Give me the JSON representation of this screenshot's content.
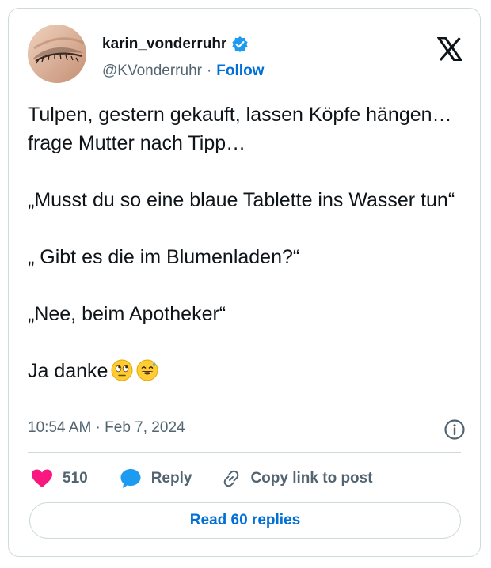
{
  "author": {
    "display_name": "karin_vonderruhr",
    "handle": "@KVonderruhr",
    "separator": "·",
    "follow_label": "Follow",
    "verified": true,
    "avatar_icon": "avatar-photo"
  },
  "tweet": {
    "text": "Tulpen, gestern gekauft, lassen Köpfe hängen…frage Mutter nach Tipp…\n\n„Musst du so eine blaue Tablette ins Wasser tun“\n\n„ Gibt es die im Blumenladen?“\n\n„Nee, beim Apotheker“\n\nJa danke",
    "emojis": [
      "face-with-rolling-eyes",
      "grinning-face-with-sweat"
    ],
    "timestamp": "10:54 AM · Feb 7, 2024"
  },
  "actions": {
    "like_count": "510",
    "reply_label": "Reply",
    "copy_link_label": "Copy link to post"
  },
  "read_replies_label": "Read 60 replies",
  "colors": {
    "accent_blue": "#006fd6",
    "verified_blue": "#1d9bf0",
    "like_pink": "#f91880",
    "reply_blue": "#1d9bf0",
    "text_primary": "#0f1419",
    "text_secondary": "#536471",
    "border": "#cfd9de"
  }
}
